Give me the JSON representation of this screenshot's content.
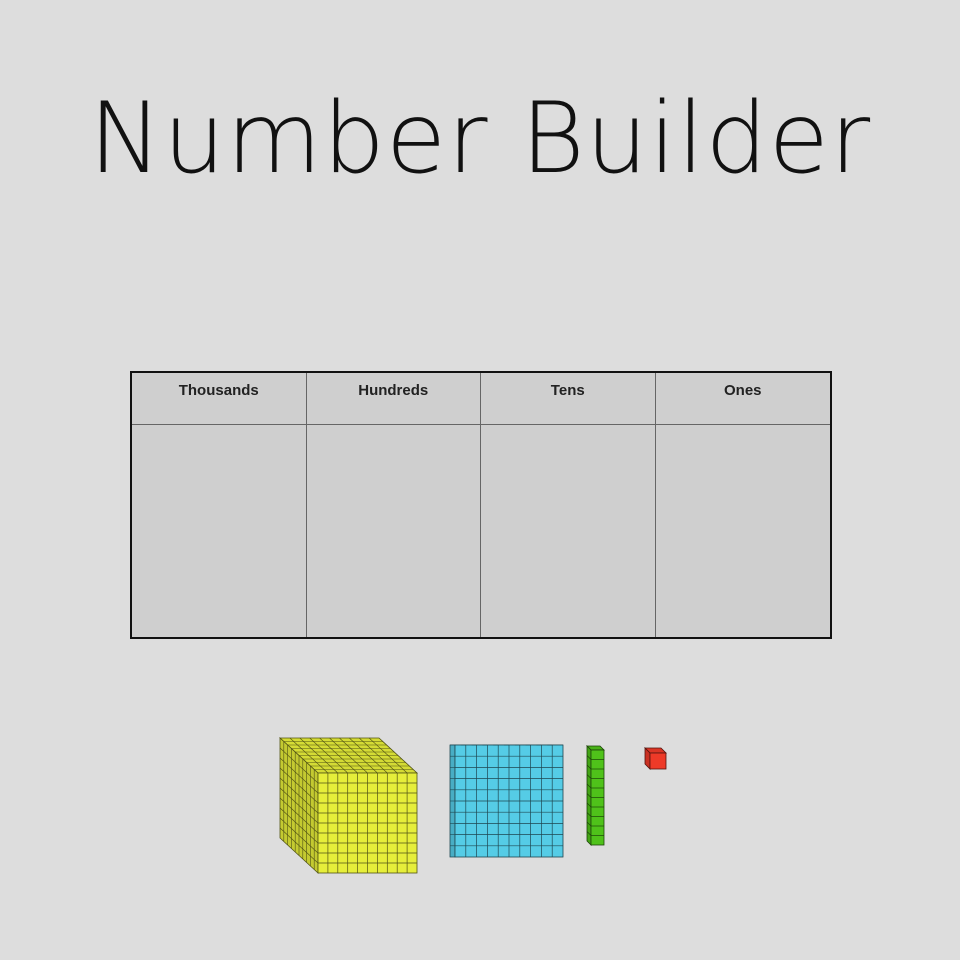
{
  "title": "Number Builder",
  "place_value_chart": {
    "columns": [
      "Thousands",
      "Hundreds",
      "Tens",
      "Ones"
    ]
  },
  "blocks": [
    {
      "name": "thousands-cube",
      "color": "#e6ee3a"
    },
    {
      "name": "hundreds-flat",
      "color": "#55cce6"
    },
    {
      "name": "tens-rod",
      "color": "#4fc21a"
    },
    {
      "name": "ones-unit",
      "color": "#ee3a28"
    }
  ]
}
